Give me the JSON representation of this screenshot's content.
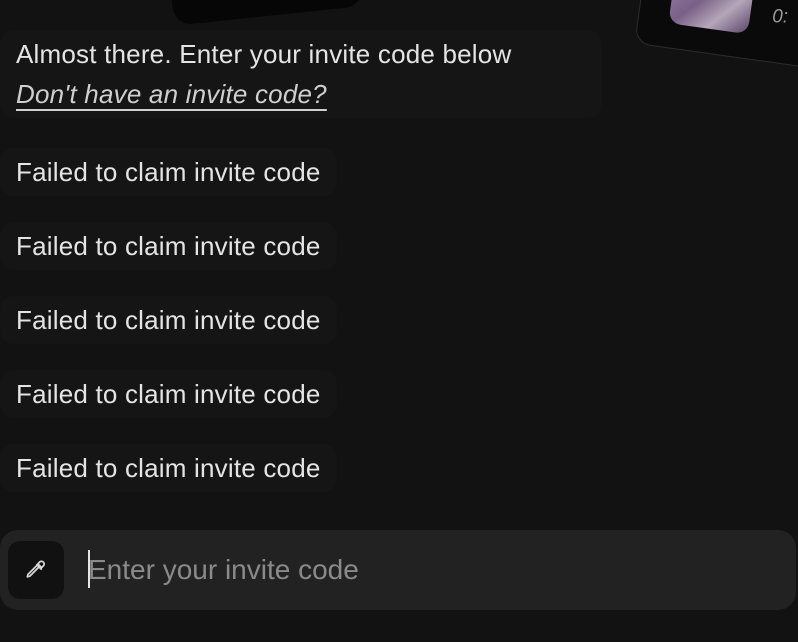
{
  "background_color": "#121212",
  "top_cards": {
    "right_card_time": "0:"
  },
  "messages": {
    "intro_text": "Almost there. Enter your invite code below",
    "invite_link": "Don't have an invite code?",
    "errors": [
      "Failed to claim invite code",
      "Failed to claim invite code",
      "Failed to claim invite code",
      "Failed to claim invite code",
      "Failed to claim invite code"
    ]
  },
  "composer": {
    "value": "",
    "placeholder": "Enter your invite code",
    "action_icon": "eyedropper-icon"
  }
}
